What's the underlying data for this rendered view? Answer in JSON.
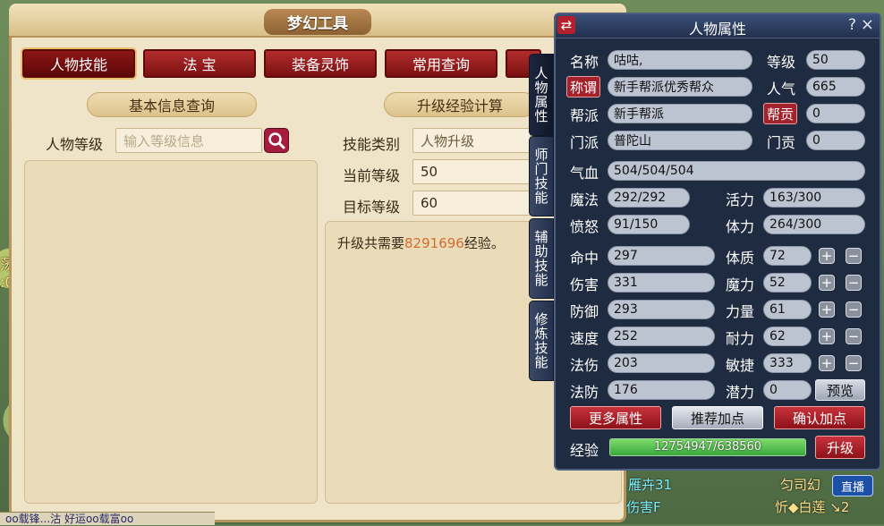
{
  "tool": {
    "title": "梦幻工具",
    "tabs": [
      "人物技能",
      "法 宝",
      "装备灵饰",
      "常用查询",
      ""
    ],
    "left_section": "基本信息查询",
    "right_section": "升级经验计算",
    "level_label": "人物等级",
    "level_placeholder": "输入等级信息",
    "skill_type_label": "技能类别",
    "skill_type_value": "人物升级",
    "current_level_label": "当前等级",
    "current_level_value": "50",
    "target_level_label": "目标等级",
    "target_level_value": "60",
    "result_prefix": "升级共需要",
    "result_number": "8291696",
    "result_suffix": "经验。",
    "side_tabs": [
      "人物属性",
      "师门技能",
      "辅助技能",
      "修炼技能"
    ]
  },
  "attr": {
    "title": "人物属性",
    "help": "?",
    "close": "×",
    "swap": "⇄",
    "name_label": "名称",
    "name": "咕咕,",
    "level_label": "等级",
    "level": "50",
    "title_label": "称谓",
    "title_value": "新手帮派优秀帮众",
    "pop_label": "人气",
    "pop": "665",
    "gang_label": "帮派",
    "gang": "新手帮派",
    "contrib_label": "帮贡",
    "contrib": "0",
    "sect_label": "门派",
    "sect": "普陀山",
    "sect_contrib_label": "门贡",
    "sect_contrib": "0",
    "hp_label": "气血",
    "hp": "504/504/504",
    "mp_label": "魔法",
    "mp": "292/292",
    "vit_label": "活力",
    "vit": "163/300",
    "anger_label": "愤怒",
    "anger": "91/150",
    "stam_label": "体力",
    "stam": "264/300",
    "stats_left": [
      {
        "label": "命中",
        "value": "297"
      },
      {
        "label": "伤害",
        "value": "331"
      },
      {
        "label": "防御",
        "value": "293"
      },
      {
        "label": "速度",
        "value": "252"
      },
      {
        "label": "法伤",
        "value": "203"
      },
      {
        "label": "法防",
        "value": "176"
      }
    ],
    "stats_right": [
      {
        "label": "体质",
        "value": "72"
      },
      {
        "label": "魔力",
        "value": "52"
      },
      {
        "label": "力量",
        "value": "61"
      },
      {
        "label": "耐力",
        "value": "62"
      },
      {
        "label": "敏捷",
        "value": "333"
      },
      {
        "label": "潜力",
        "value": "0"
      }
    ],
    "plus": "+",
    "minus": "−",
    "preview": "预览",
    "more": "更多属性",
    "recommend": "推荐加点",
    "confirm": "确认加点",
    "exp_label": "经验",
    "exp_value": "12754947/638560",
    "upgrade": "升级"
  },
  "game": {
    "text1": "雁卉31",
    "text2": "伤害F",
    "text3": "匀司幻",
    "text4": "忻◆白莲 ↘2",
    "live": "直播",
    "bottom": "oo载锋...沽  好运oo载富oo"
  }
}
